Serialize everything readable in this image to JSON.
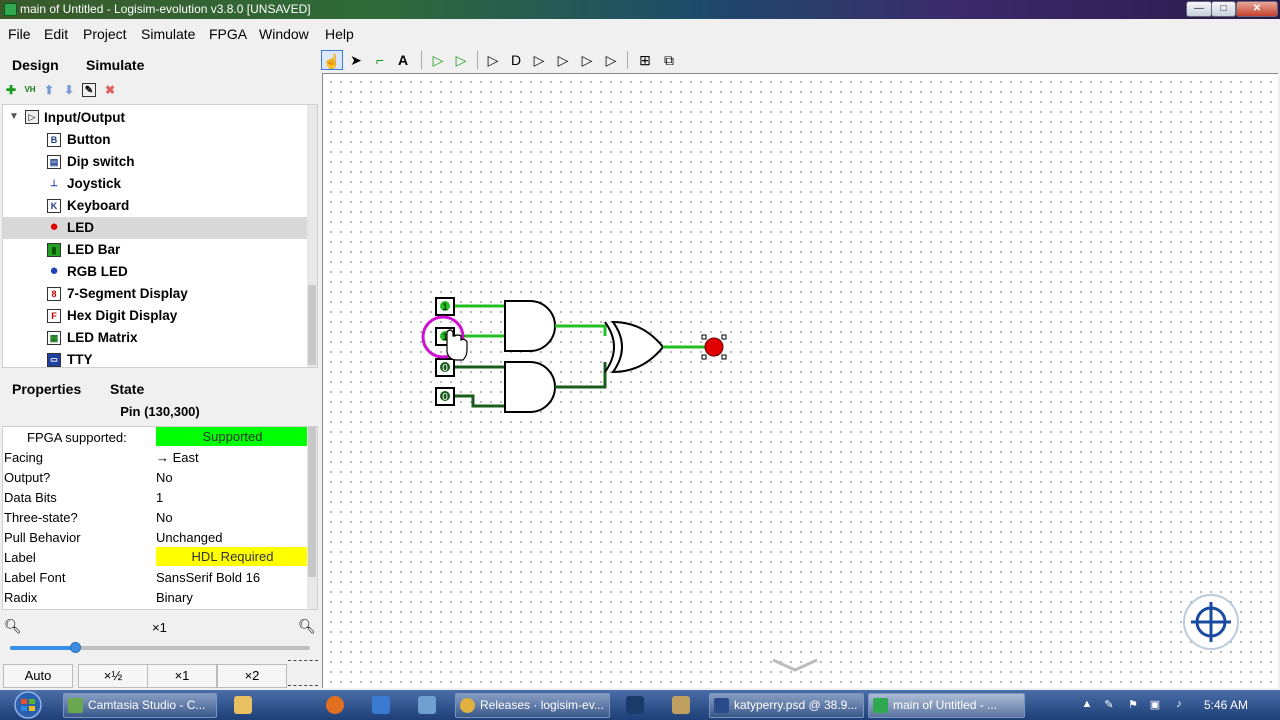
{
  "window": {
    "title": "main of Untitled - Logisim-evolution v3.8.0 [UNSAVED]",
    "min": "—",
    "max": "□",
    "close": "✕"
  },
  "menu": [
    "File",
    "Edit",
    "Project",
    "Simulate",
    "FPGA",
    "Window",
    "Help"
  ],
  "design_tabs": {
    "design": "Design",
    "simulate": "Simulate"
  },
  "library_toolbar": [
    "add-icon",
    "vhdl-icon",
    "up-icon",
    "down-icon",
    "edit-icon",
    "delete-icon"
  ],
  "tree": {
    "group": "Input/Output",
    "items": [
      {
        "label": "Button",
        "icon": "B"
      },
      {
        "label": "Dip switch",
        "icon": "▤"
      },
      {
        "label": "Joystick",
        "icon": "⊥"
      },
      {
        "label": "Keyboard",
        "icon": "K"
      },
      {
        "label": "LED",
        "icon": "●",
        "selected": true
      },
      {
        "label": "LED Bar",
        "icon": "▮"
      },
      {
        "label": "RGB LED",
        "icon": "●"
      },
      {
        "label": "7-Segment Display",
        "icon": "8"
      },
      {
        "label": "Hex Digit Display",
        "icon": "F"
      },
      {
        "label": "LED Matrix",
        "icon": "▦"
      },
      {
        "label": "TTY",
        "icon": "▭"
      }
    ]
  },
  "prop_tabs": {
    "properties": "Properties",
    "state": "State"
  },
  "selection_title": "Pin (130,300)",
  "properties": [
    {
      "name": "FPGA supported:",
      "value": "Supported",
      "style": "green"
    },
    {
      "name": "Facing",
      "value": "→ East"
    },
    {
      "name": "Output?",
      "value": "No"
    },
    {
      "name": "Data Bits",
      "value": "1"
    },
    {
      "name": "Three-state?",
      "value": "No"
    },
    {
      "name": "Pull Behavior",
      "value": "Unchanged"
    },
    {
      "name": "Label",
      "value": "HDL Required",
      "style": "yellow"
    },
    {
      "name": "Label Font",
      "value": "SansSerif Bold 16"
    },
    {
      "name": "Radix",
      "value": "Binary"
    }
  ],
  "zoom": {
    "level_label": "×1",
    "buttons": [
      "Auto",
      "×½",
      "×1",
      "×2"
    ],
    "slider_fraction": 0.22
  },
  "circuit": {
    "pins": [
      "1",
      "1",
      "0",
      "0"
    ]
  },
  "taskbar": {
    "buttons": [
      {
        "label": "Camtasia Studio - C...",
        "color": "#6aa84f"
      },
      {
        "label": "Releases · logisim-ev...",
        "color": "#e0b040"
      },
      {
        "label": "katyperry.psd @ 38.9...",
        "color": "#2a4a8a"
      },
      {
        "label": "main of Untitled - ...",
        "color": "#2fa84f"
      }
    ],
    "time": "5:46 AM"
  },
  "colors": {
    "wire_on": "#22c022",
    "wire_off": "#1a5c1a",
    "led": "#e00000",
    "selection": "#d010d0"
  }
}
